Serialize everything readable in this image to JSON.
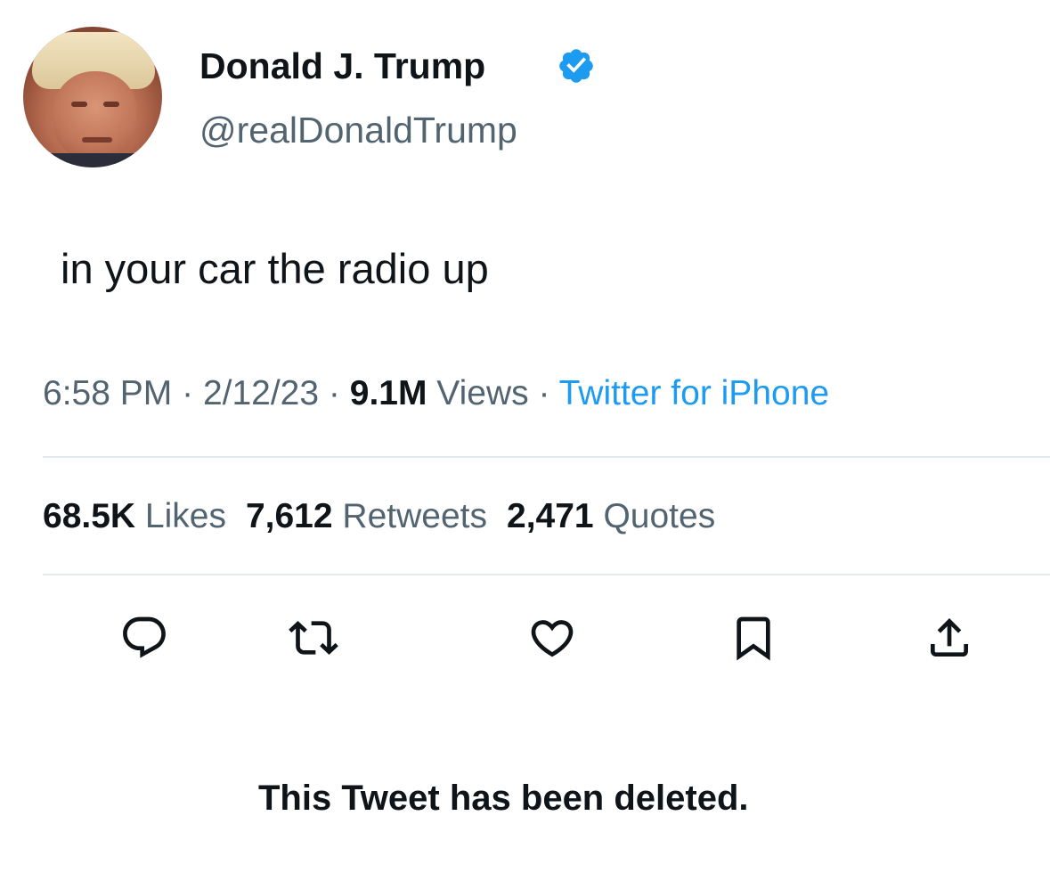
{
  "author": {
    "display_name": "Donald J. Trump",
    "handle": "@realDonaldTrump",
    "verified": true,
    "verified_color": "#1d9bf0"
  },
  "tweet": {
    "text": "in your car the radio up",
    "time": "6:58 PM",
    "date": "2/12/23",
    "views_count": "9.1M",
    "views_label": "Views",
    "source": "Twitter for iPhone",
    "separator": "·"
  },
  "stats": {
    "likes_count": "68.5K",
    "likes_label": "Likes",
    "retweets_count": "7,612",
    "retweets_label": "Retweets",
    "quotes_count": "2,471",
    "quotes_label": "Quotes"
  },
  "actions": {
    "icons": [
      "reply-icon",
      "retweet-icon",
      "like-icon",
      "bookmark-icon",
      "share-icon"
    ]
  },
  "notice": {
    "text": "This Tweet has been deleted."
  },
  "colors": {
    "text_primary": "#0f1419",
    "text_secondary": "#536471",
    "link": "#1d9bf0",
    "divider": "#e3e8eb"
  }
}
